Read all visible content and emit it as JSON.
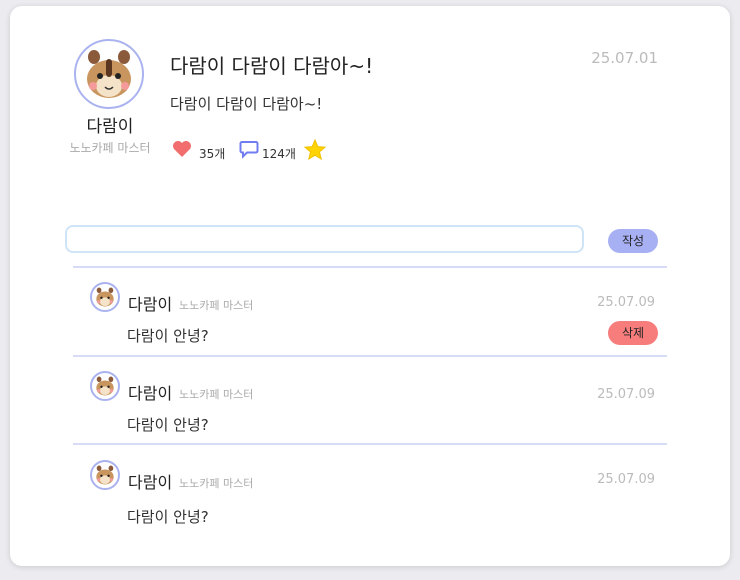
{
  "post": {
    "author_name": "다람이",
    "author_role": "노노카페 마스터",
    "title": "다람이 다람이 다람아~!",
    "date": "25.07.01",
    "body": "다람이 다람이 다람아~!",
    "likes": "35개",
    "comments": "124개"
  },
  "comment_form": {
    "placeholder": "",
    "submit_label": "작성"
  },
  "comments": [
    {
      "name": "다람이",
      "role": "노노카페 마스터",
      "date": "25.07.09",
      "text": "다람이 안녕?",
      "delete_label": "삭제"
    },
    {
      "name": "다람이",
      "role": "노노카페 마스터",
      "date": "25.07.09",
      "text": "다람이 안녕?"
    },
    {
      "name": "다람이",
      "role": "노노카페 마스터",
      "date": "25.07.09",
      "text": "다람이 안녕?"
    }
  ],
  "icons": {
    "heart": "heart-icon",
    "comment": "comment-icon",
    "star": "star-icon"
  },
  "colors": {
    "accent": "#a8b0f4",
    "delete": "#f77d7d",
    "heart": "#f26d6d",
    "star": "#ffd400",
    "comment_icon": "#6f7df0"
  }
}
